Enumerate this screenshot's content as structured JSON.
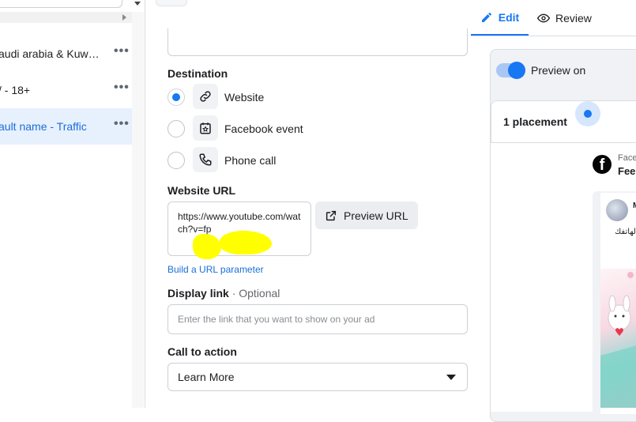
{
  "sidebar": {
    "items": [
      {
        "label": "audi arabia & Kuw…",
        "selected": false
      },
      {
        "label": "/ - 18+",
        "selected": false
      },
      {
        "label": "ault name - Traffic",
        "selected": true
      }
    ],
    "more_label": "•••"
  },
  "tabs": {
    "edit_label": "Edit",
    "review_label": "Review"
  },
  "destination": {
    "title": "Destination",
    "options": [
      {
        "label": "Website",
        "icon": "link-icon",
        "selected": true
      },
      {
        "label": "Facebook event",
        "icon": "calendar-star-icon",
        "selected": false
      },
      {
        "label": "Phone call",
        "icon": "phone-icon",
        "selected": false
      }
    ]
  },
  "website_url": {
    "title": "Website URL",
    "value": "https://www.youtube.com/watch?v=fp",
    "preview_button": "Preview URL",
    "build_param_link": "Build a URL parameter"
  },
  "display_link": {
    "title": "Display link",
    "optional": " · Optional",
    "placeholder": "Enter the link that you want to show on your ad"
  },
  "call_to_action": {
    "title": "Call to action",
    "value": "Learn More"
  },
  "preview": {
    "toggle_label": "Preview on",
    "toggle_on": true,
    "placement_label": "1 placement",
    "page_line_1": "Face",
    "page_line_2": "Fee",
    "post_text": "ة لهاتفك",
    "post_author_initial": "M"
  },
  "colors": {
    "accent": "#1877f2",
    "selected_row_bg": "#e7f0fd",
    "redaction": "#ffff00"
  }
}
